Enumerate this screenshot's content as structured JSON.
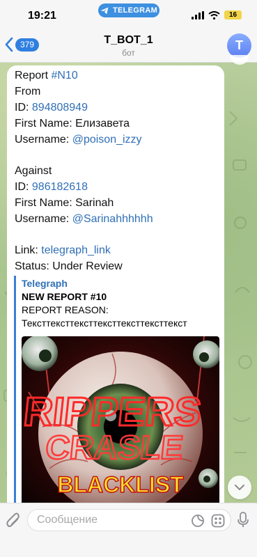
{
  "status_bar": {
    "time": "19:21",
    "app_pill": "TELEGRAM",
    "battery": "16"
  },
  "header": {
    "back_count": "379",
    "title": "T_BOT_1",
    "subtitle": "бот",
    "avatar_letter": "T"
  },
  "message": {
    "line1_label": "Report ",
    "line1_value": "#N10",
    "from_label": "From",
    "from_id_label": "ID: ",
    "from_id": "894808949",
    "from_first_name_label": "First Name: ",
    "from_first_name": "Елизавета",
    "from_username_label": "Username: ",
    "from_username": "@poison_izzy",
    "against_label": "Against",
    "against_id_label": "ID: ",
    "against_id": "986182618",
    "against_first_name_label": "First Name: ",
    "against_first_name": "Sarinah",
    "against_username_label": "Username: ",
    "against_username": "@Sarinahhhhhh",
    "link_label": "Link: ",
    "link_text": "telegraph_link",
    "status_label": "Status: ",
    "status_value": "Under Review"
  },
  "preview": {
    "site_name": "Telegraph",
    "title": "NEW REPORT #10",
    "reason_label": "REPORT REASON:",
    "reason_text": "Тексттексттексттексттексттексттекст",
    "image_text_top": "RIPPERS",
    "image_text_mid": "CRASLE",
    "image_text_bottom": "BLACKLIST"
  },
  "input": {
    "placeholder": "Сообщение"
  },
  "colors": {
    "accent": "#2f7fe0",
    "link": "#2f6fb6",
    "telegram_pill": "#3d8fe0",
    "battery": "#f1d44a"
  },
  "icons": [
    "telegram-plane-icon",
    "signal-icon",
    "wifi-icon",
    "back-chevron-icon",
    "attach-icon",
    "sticker-icon",
    "bot-commands-icon",
    "mic-icon",
    "chevron-down-icon"
  ]
}
